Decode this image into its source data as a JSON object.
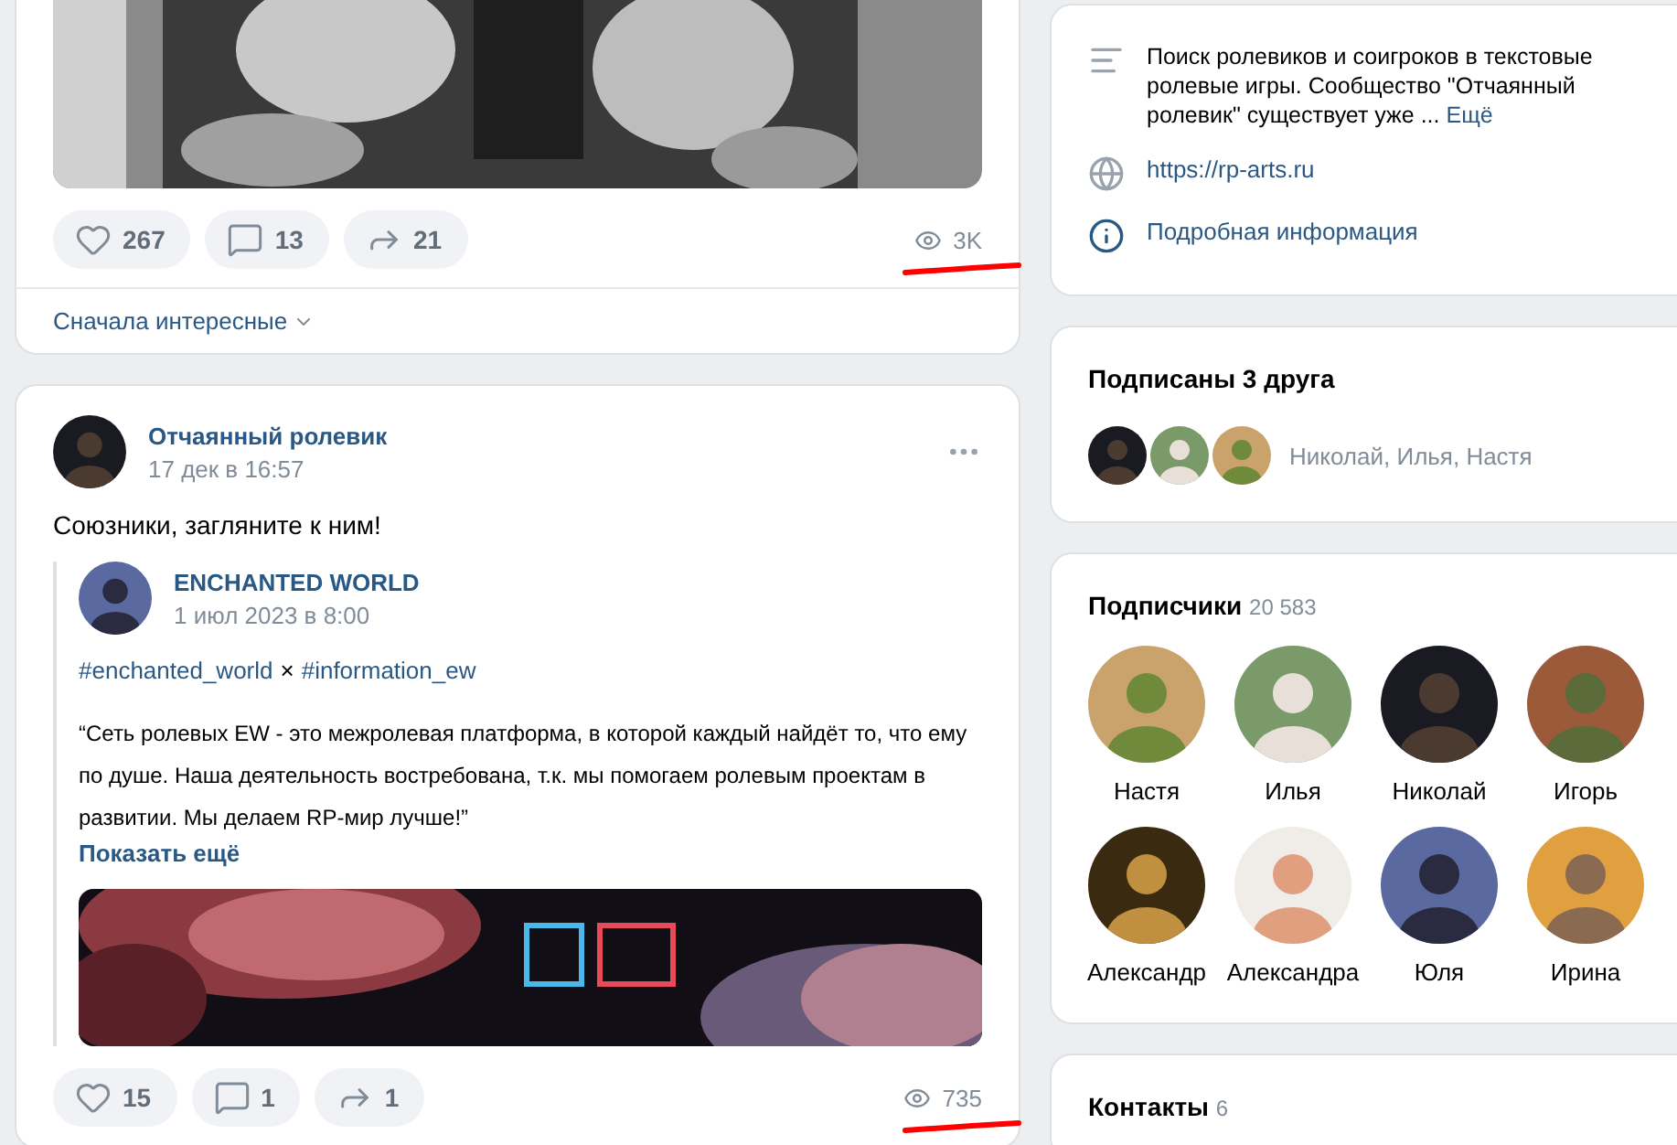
{
  "feed": {
    "top_post": {
      "photo": {
        "kind": "picture"
      },
      "actions": [
        {
          "kind": "like",
          "count": "267"
        },
        {
          "kind": "comment",
          "count": "13"
        },
        {
          "kind": "share",
          "count": "21"
        }
      ],
      "views": "3K",
      "underlined": true,
      "comments_sort": "Сначала интересные"
    },
    "post": {
      "author": "Отчаянный ролевик",
      "time": "17 дек в 16:57",
      "text": "Союзники, загляните к ним!",
      "repost": {
        "author": "ENCHANTED WORLD",
        "time": "1 июл 2023 в 8:00",
        "tags": [
          "#enchanted_world",
          "#information_ew"
        ],
        "separator": "×",
        "quote": "“Сеть ролевых EW - это межролевая платформа, в которой каждый найдёт то, что ему по душе. Наша деятельность востребована, т.к. мы помогаем ролевым проектам в развитии. Мы делаем RP-мир лучше!”",
        "more": "Показать ещё",
        "banner": {
          "kind": "picture"
        }
      },
      "actions": [
        {
          "kind": "like",
          "count": "15"
        },
        {
          "kind": "comment",
          "count": "1"
        },
        {
          "kind": "share",
          "count": "1"
        }
      ],
      "views": "735",
      "underlined": true
    }
  },
  "sidebar": {
    "about": {
      "description": "Поиск ролевиков и соигроков в текстовые ролевые игры. Сообщество \"Отчаянный ролевик\" существует уже ...",
      "more": "Ещё",
      "link": "https://rp-arts.ru",
      "details": "Подробная информация"
    },
    "friends": {
      "title": "Подписаны 3 друга",
      "names": "Николай, Илья, Настя"
    },
    "followers": {
      "title": "Подписчики",
      "count": "20 583",
      "items": [
        {
          "name": "Настя"
        },
        {
          "name": "Илья"
        },
        {
          "name": "Николай"
        },
        {
          "name": "Игорь"
        },
        {
          "name": "Александр"
        },
        {
          "name": "Александра"
        },
        {
          "name": "Юля"
        },
        {
          "name": "Ирина"
        }
      ]
    },
    "contacts": {
      "title": "Контакты",
      "count": "6"
    }
  }
}
